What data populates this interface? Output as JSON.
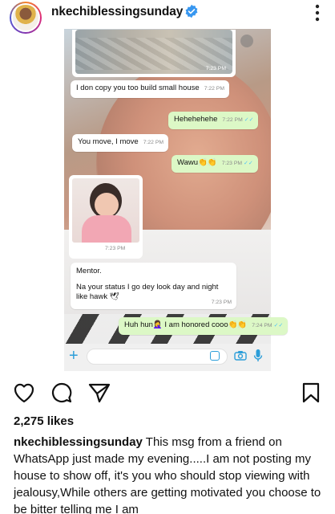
{
  "post": {
    "username": "nkechiblessingsunday",
    "likes": "2,275 likes",
    "caption_user": "nkechiblessingsunday",
    "caption_text": "This msg from a friend on WhatsApp just made my evening.....I am not posting my house to show off, it's you who should stop viewing with jealousy,While others are getting motivated you choose to be bitter telling me I am"
  },
  "chat": {
    "image_time": "7:23 PM",
    "messages": [
      {
        "text": "I don copy you too build small house",
        "time": "7:22 PM"
      },
      {
        "text": "Hehehehehe",
        "time": "7:22 PM"
      },
      {
        "text": "You move, I move",
        "time": "7:22 PM"
      },
      {
        "text": "Wawu👏👏",
        "time": "7:23 PM"
      },
      {
        "text": "Huh hun🤦‍♀️ I am honored cooo👏👏",
        "time": "7:24 PM"
      }
    ],
    "photo_time": "7:23 PM",
    "long_message": {
      "line1": "Mentor.",
      "line2": "Na your status I go dey look day and night",
      "line3": "like hawk 🕊",
      "time": "7:23 PM"
    }
  },
  "icons": {
    "verified": "verified-badge-icon",
    "more": "more-options-icon",
    "like": "heart-icon",
    "comment": "comment-icon",
    "share": "paper-plane-icon",
    "save": "bookmark-icon"
  },
  "colors": {
    "verified": "#3897f0",
    "wa_out": "#dcf8c6",
    "wa_accent": "#2c9ed9"
  }
}
